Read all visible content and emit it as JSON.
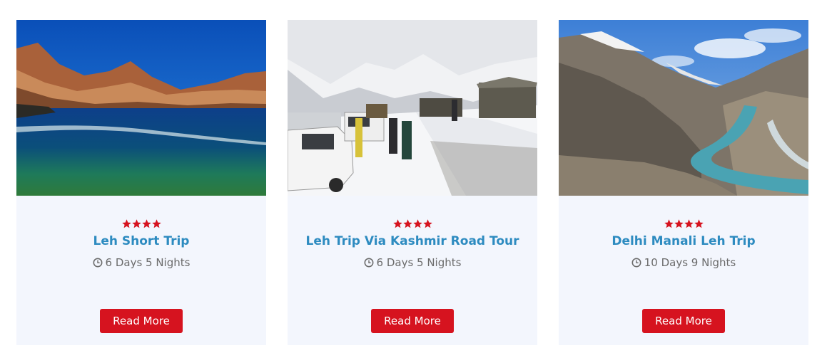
{
  "cards": [
    {
      "title": "Leh Short Trip",
      "duration": "6 Days 5 Nights",
      "rating": 4,
      "button": "Read More"
    },
    {
      "title": "Leh Trip Via Kashmir Road Tour",
      "duration": "6 Days 5 Nights",
      "rating": 4,
      "button": "Read More"
    },
    {
      "title": "Delhi Manali Leh Trip",
      "duration": "10 Days 9 Nights",
      "rating": 4,
      "button": "Read More"
    }
  ],
  "icons": {
    "rating": "star-icon",
    "duration": "clock-icon"
  },
  "colors": {
    "title": "#2d8bc0",
    "star": "#d6131f",
    "button": "#d6131f",
    "card_bg": "#f3f6fd",
    "muted": "#6b6b6b"
  }
}
